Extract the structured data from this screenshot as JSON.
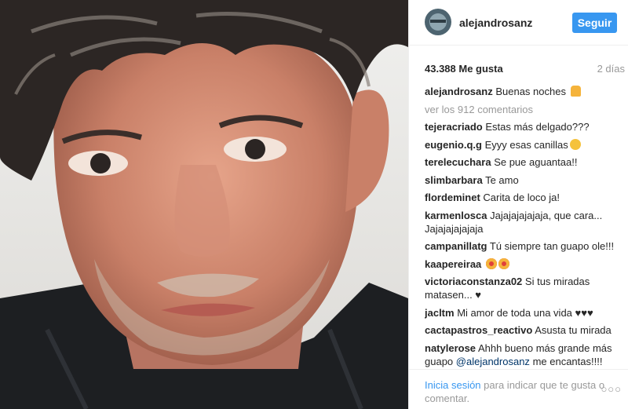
{
  "post": {
    "username": "alejandrosanz",
    "follow_label": "Seguir",
    "likes": "43.388 Me gusta",
    "time": "2 días",
    "caption": {
      "user": "alejandrosanz",
      "text": "Buenas noches"
    },
    "view_comments": "ver los 912 comentarios",
    "comments": [
      {
        "user": "tejeracriado",
        "text": "Estas más delgado???"
      },
      {
        "user": "eugenio.q.g",
        "text": "Eyyy esas canillas"
      },
      {
        "user": "terelecuchara",
        "text": "Se pue aguantaa!!"
      },
      {
        "user": "slimbarbara",
        "text": "Te amo"
      },
      {
        "user": "flordeminet",
        "text": "Carita de loco ja!"
      },
      {
        "user": "karmenlosca",
        "text": "Jajajajajajaja, que cara... Jajajajajajaja"
      },
      {
        "user": "campanillatg",
        "text": "Tú siempre tan guapo ole!!!"
      },
      {
        "user": "kaapereiraa",
        "text": ""
      },
      {
        "user": "victoriaconstanza02",
        "text": "Si tus miradas matasen... ♥"
      },
      {
        "user": "jacltm",
        "text": "Mi amor de toda una vida ♥♥♥"
      },
      {
        "user": "cactapastros_reactivo",
        "text": "Asusta tu mirada"
      },
      {
        "user": "natylerose",
        "text": "Ahhh bueno más grande más guapo",
        "mention": "@alejandrosanz",
        "after": "me encantas!!!!"
      }
    ],
    "login_link": "Inicia sesión",
    "login_text": "para indicar que te gusta o comentar.",
    "more_options": "○○○"
  }
}
